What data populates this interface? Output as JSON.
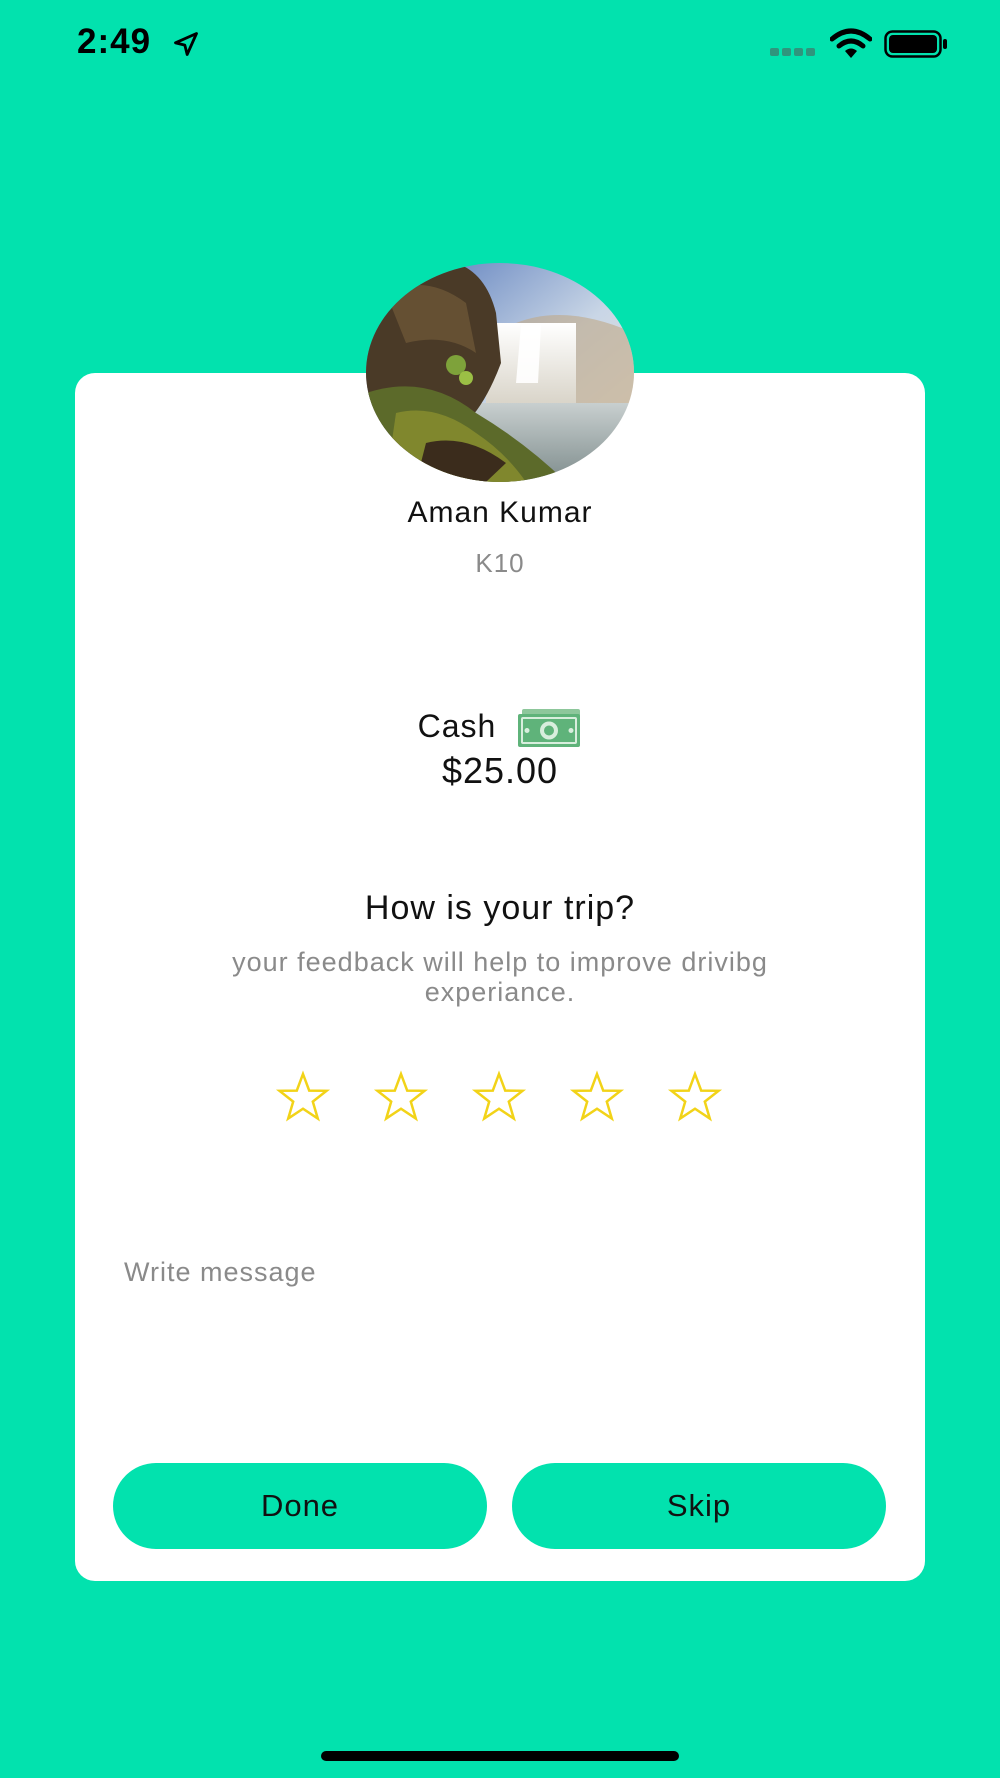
{
  "status_bar": {
    "time": "2:49",
    "icons": [
      "location-arrow-icon",
      "cellular-signal-icon",
      "wifi-icon",
      "battery-icon"
    ]
  },
  "driver": {
    "avatar": "waterfall-landscape-photo",
    "name": "Aman Kumar",
    "vehicle_code": "K10"
  },
  "payment": {
    "method": "Cash",
    "icon": "cash-money-icon",
    "amount": "$25.00"
  },
  "rating": {
    "title": "How is your trip?",
    "subtitle": "your feedback will help to improve drivibg experiance.",
    "stars_total": 5,
    "stars_selected": 0,
    "star_color": "#f2d318"
  },
  "message": {
    "placeholder": "Write message",
    "value": ""
  },
  "actions": {
    "done_label": "Done",
    "skip_label": "Skip"
  },
  "colors": {
    "accent": "#02e2ae",
    "card": "#ffffff",
    "secondary_text": "#8a8a8a"
  }
}
